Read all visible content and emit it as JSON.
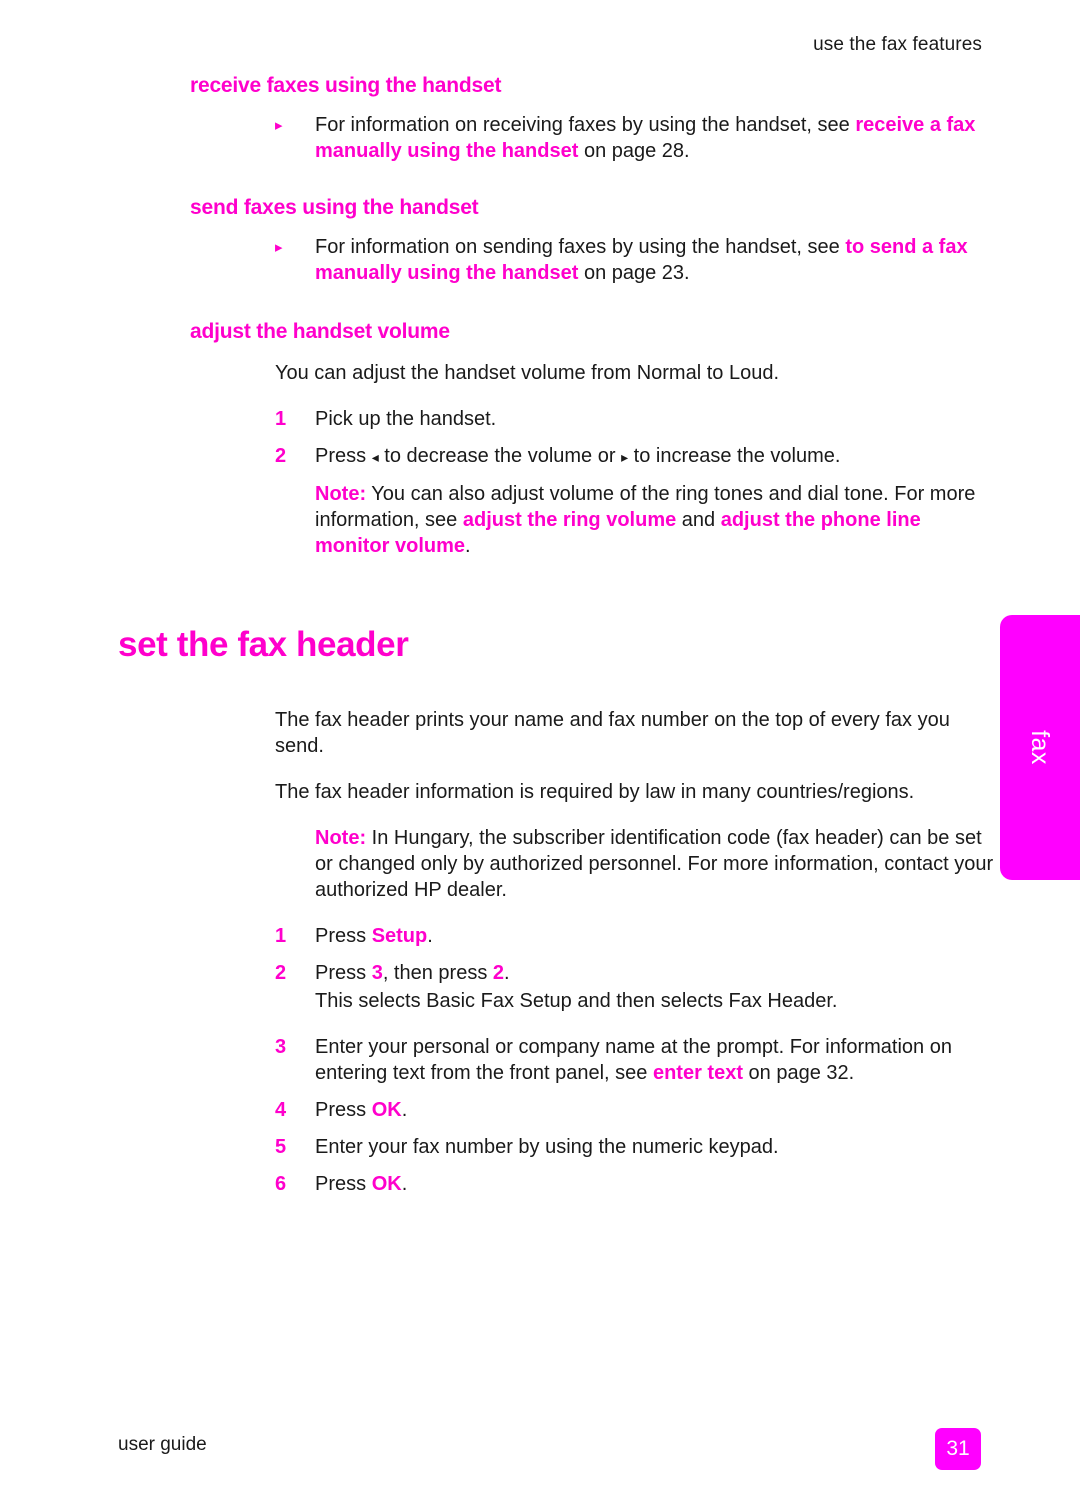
{
  "running_header": "use the fax features",
  "sections": {
    "receive": {
      "heading": "receive faxes using the handset",
      "bullet": {
        "marker": "▸",
        "lead": "For information on receiving faxes by using the handset, see ",
        "link": "receive a fax manually using the handset",
        "tail": " on page 28."
      }
    },
    "send": {
      "heading": "send faxes using the handset",
      "bullet": {
        "marker": "▸",
        "lead": "For information on sending faxes by using the handset, see ",
        "link": "to send a fax manually using the handset",
        "tail": " on page 23."
      }
    },
    "adjust": {
      "heading": "adjust the handset volume",
      "intro": "You can adjust the handset volume from Normal to Loud.",
      "steps": [
        {
          "num": "1",
          "text": "Pick up the handset."
        },
        {
          "num": "2",
          "prefix": "Press ",
          "left_arrow": "◂",
          "middle": " to decrease the volume or ",
          "right_arrow": "▸",
          "suffix": " to increase the volume."
        }
      ],
      "note": {
        "label": "Note:",
        "lead": " You can also adjust volume of the ring tones and dial tone. For more information, see ",
        "link1": "adjust the ring volume",
        "conjunction": " and ",
        "link2": "adjust the phone line monitor volume",
        "tail": "."
      }
    },
    "fax_header": {
      "heading": "set the fax header",
      "para1": "The fax header prints your name and fax number on the top of every fax you send.",
      "para2": "The fax header information is required by law in many countries/regions.",
      "note": {
        "label": "Note:",
        "text": " In Hungary, the subscriber identification code (fax header) can be set or changed only by authorized personnel. For more information, contact your authorized HP dealer."
      },
      "steps": [
        {
          "num": "1",
          "prefix": "Press ",
          "key": "Setup",
          "suffix": "."
        },
        {
          "num": "2",
          "prefix": "Press ",
          "key": "3",
          "middle": ", then press ",
          "key2": "2",
          "suffix": ".",
          "sub": "This selects Basic Fax Setup and then selects Fax Header."
        },
        {
          "num": "3",
          "lead": "Enter your personal or company name at the prompt. For information on entering text from the front panel, see ",
          "link": "enter text",
          "tail": " on page 32."
        },
        {
          "num": "4",
          "prefix": "Press ",
          "key": "OK",
          "suffix": "."
        },
        {
          "num": "5",
          "text": "Enter your fax number by using the numeric keypad."
        },
        {
          "num": "6",
          "prefix": "Press ",
          "key": "OK",
          "suffix": "."
        }
      ]
    }
  },
  "side_tab": {
    "label": "fax",
    "color": "#FF00FF"
  },
  "footer": {
    "label": "user guide",
    "page_number": "31"
  },
  "colors": {
    "accent": "#FF00CC",
    "tab": "#FF00FF",
    "body_text": "#1A1A1A"
  }
}
